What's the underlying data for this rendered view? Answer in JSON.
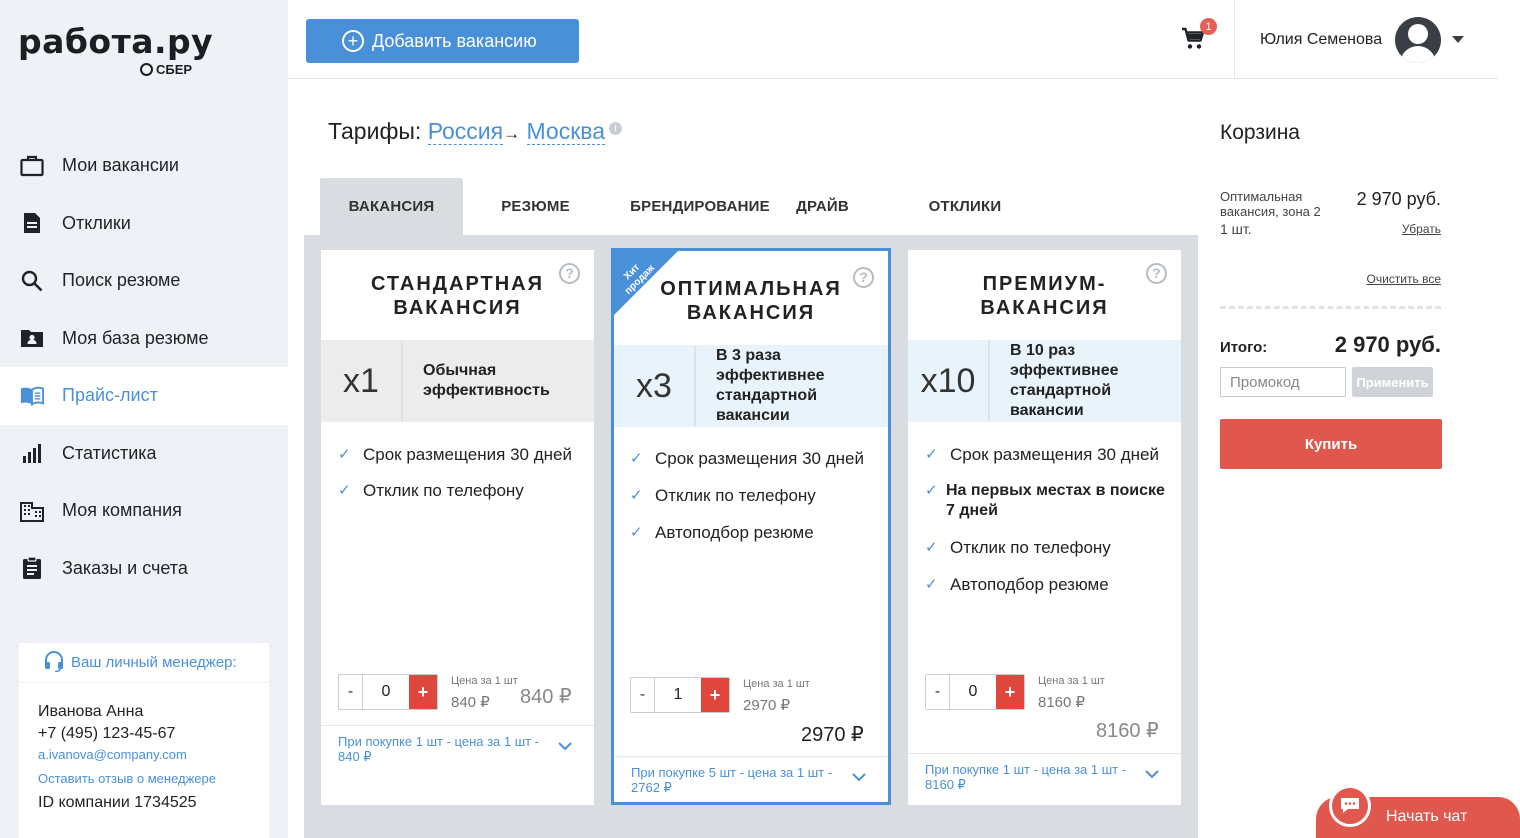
{
  "brand": {
    "name": "работа.ру",
    "sub": "СБЕР"
  },
  "sidebar": {
    "items": [
      {
        "label": "Мои вакансии",
        "icon": "briefcase-icon"
      },
      {
        "label": "Отклики",
        "icon": "document-icon"
      },
      {
        "label": "Поиск резюме",
        "icon": "search-icon"
      },
      {
        "label": "Моя база резюме",
        "icon": "folder-user-icon"
      },
      {
        "label": "Прайс-лист",
        "icon": "book-icon",
        "active": true
      },
      {
        "label": "Статистика",
        "icon": "chart-icon"
      },
      {
        "label": "Моя компания",
        "icon": "building-icon"
      },
      {
        "label": "Заказы и счета",
        "icon": "clipboard-icon"
      }
    ],
    "manager": {
      "heading": "Ваш личный менеджер:",
      "name": "Иванова Анна",
      "phone": "+7 (495) 123-45-67",
      "email": "a.ivanova@company.com",
      "feedback": "Оставить отзыв о менеджере",
      "company_id": "ID компании 1734525"
    }
  },
  "header": {
    "add_button": "Добавить вакансию",
    "cart_count": "1",
    "user_name": "Юлия Семенова"
  },
  "title": {
    "prefix": "Тарифы:",
    "region": "Россия",
    "arrow": "→",
    "city": "Москва"
  },
  "tabs": [
    "ВАКАНСИЯ",
    "РЕЗЮМЕ",
    "БРЕНДИРОВАНИЕ",
    "ДРАЙВ",
    "ОТКЛИКИ"
  ],
  "cards": [
    {
      "title1": "СТАНДАРТНАЯ",
      "title2": "ВАКАНСИЯ",
      "mult": "x1",
      "desc": [
        "Обычная",
        "эффективность"
      ],
      "features": [
        "Срок размещения 30 дней",
        "Отклик по телефону"
      ],
      "qty": "0",
      "price_label": "Цена за 1 шт",
      "price_unit": "840 ₽",
      "price_total": "840 ₽",
      "footer": "При покупке 1 шт - цена за 1 шт - 840 ₽"
    },
    {
      "ribbon": "Хит продаж",
      "title1": "ОПТИМАЛЬНАЯ",
      "title2": "ВАКАНСИЯ",
      "mult": "x3",
      "desc": [
        "В 3 раза",
        "эффективнее",
        "стандартной",
        "вакансии"
      ],
      "features": [
        "Срок размещения 30 дней",
        "Отклик по телефону",
        "Автоподбор резюме"
      ],
      "qty": "1",
      "price_label": "Цена за 1 шт",
      "price_unit": "2970 ₽",
      "price_total": "2970 ₽",
      "footer": "При покупке 5 шт - цена за 1 шт - 2762 ₽"
    },
    {
      "title1": "ПРЕМИУМ-",
      "title2": "ВАКАНСИЯ",
      "mult": "x10",
      "desc": [
        "В 10 раз",
        "эффективнее",
        "стандартной",
        "вакансии"
      ],
      "features": [
        "Срок размещения 30 дней",
        "На первых местах в поиске 7 дней",
        "Отклик по телефону",
        "Автоподбор резюме"
      ],
      "qty": "0",
      "price_label": "Цена за 1 шт",
      "price_unit": "8160 ₽",
      "price_total": "8160 ₽",
      "footer": "При покупке 1 шт - цена за 1 шт - 8160 ₽"
    }
  ],
  "cart": {
    "title": "Корзина",
    "item_name": "Оптимальная вакансия, зона 2",
    "item_qty": "1 шт.",
    "item_price": "2 970 руб.",
    "remove": "Убрать",
    "clear": "Очистить все",
    "total_label": "Итого:",
    "total_value": "2 970 руб.",
    "promo_placeholder": "Промокод",
    "apply": "Применить",
    "buy": "Купить"
  },
  "chat": {
    "label": "Начать чат"
  },
  "colors": {
    "accent": "#4a90d9",
    "buy": "#e0574d",
    "plus": "#e0463c"
  }
}
